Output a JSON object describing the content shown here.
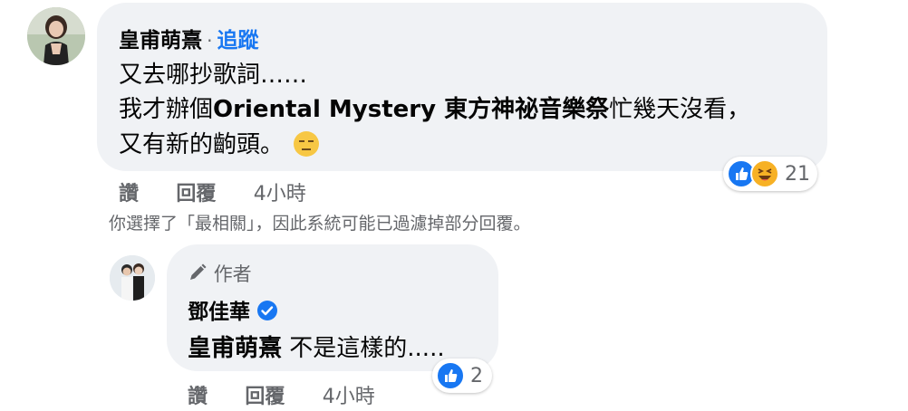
{
  "comment": {
    "author": "皇甫萌熹",
    "separator": "·",
    "follow_label": "追蹤",
    "line1": "又去哪抄歌詞……",
    "line2_pre": "我才辦個",
    "line2_bold": "Oriental Mystery 東方神祕音樂祭",
    "line2_post": "忙幾天沒看，",
    "line3": "又有新的齣頭。",
    "emoji_name": "expressionless-face-icon",
    "reaction_count": "21",
    "actions": {
      "like": "讚",
      "reply": "回覆",
      "time": "4小時"
    }
  },
  "filter_notice": "你選擇了「最相關」，因此系統可能已過濾掉部分回覆。",
  "reply": {
    "badge_label": "作者",
    "author": "鄧佳華",
    "mention": "皇甫萌熹",
    "text": "不是這樣的.....",
    "reaction_count": "2",
    "actions": {
      "like": "讚",
      "reply": "回覆",
      "time": "4小時"
    }
  },
  "colors": {
    "bubble": "#f0f2f5",
    "link": "#1877f2",
    "secondary_text": "#65676b",
    "like_blue": "#1877f2",
    "haha_yellow": "#f7b125",
    "verified_blue": "#1877f2"
  }
}
